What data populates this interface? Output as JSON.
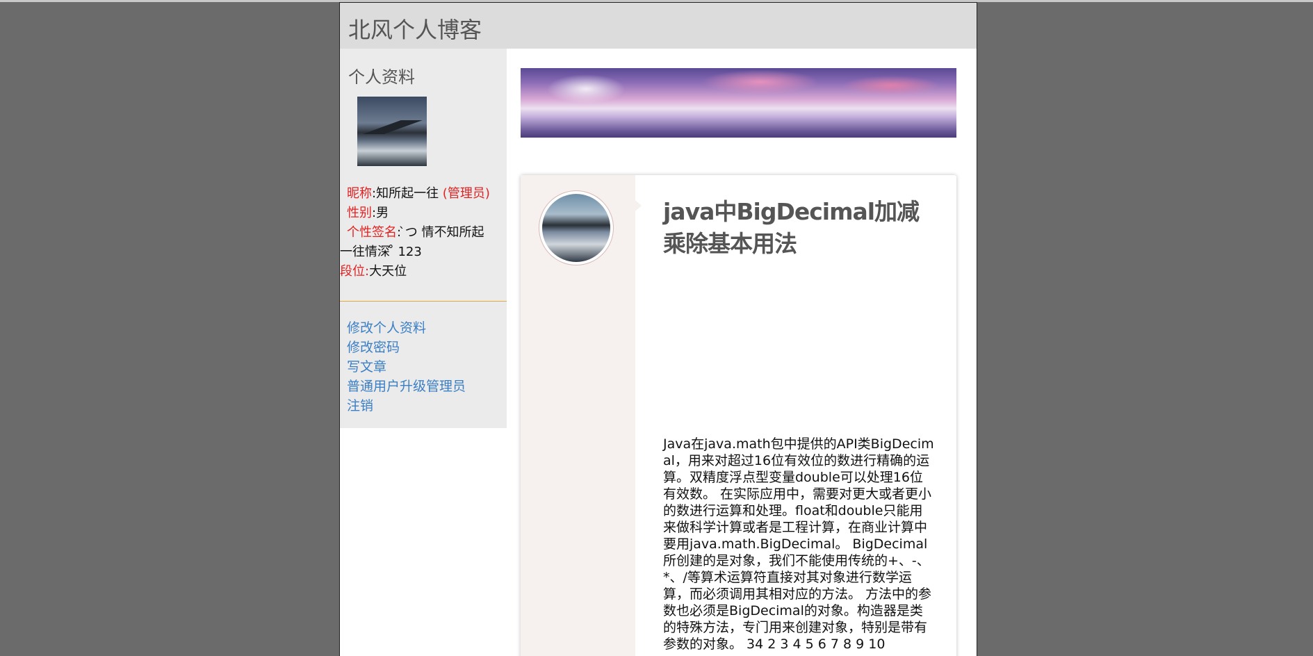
{
  "site": {
    "title": "北风个人博客"
  },
  "sidebar": {
    "heading": "个人资料",
    "profile": {
      "nickname_label": "昵称",
      "nickname_value": ":知所起一往 ",
      "role": "(管理员)",
      "gender_label": "性别",
      "gender_value": ":男",
      "signature_label": "个性签名",
      "signature_value_line1": ": ̀つ 情不知所起",
      "signature_value_line2": "一往情深 ̊ 123",
      "rank_label": "段位:",
      "rank_value": "大天位"
    },
    "links": [
      {
        "label": "修改个人资料"
      },
      {
        "label": "修改密码"
      },
      {
        "label": "写文章"
      },
      {
        "label": "普通用户升级管理员"
      },
      {
        "label": "注销"
      }
    ]
  },
  "article": {
    "title": "java中BigDecimal加减乘除基本用法",
    "body": "Java在java.math包中提供的API类BigDecimal，用来对超过16位有效位的数进行精确的运算。双精度浮点型变量double可以处理16位有效数。 在实际应用中，需要对更大或者更小的数进行运算和处理。float和double只能用来做科学计算或者是工程计算，在商业计算中要用java.math.BigDecimal。 BigDecimal所创建的是对象，我们不能使用传统的+、-、*、/等算术运算符直接对其对象进行数学运算，而必须调用其相对应的方法。 方法中的参数也必须是BigDecimal的对象。构造器是类的特殊方法，专门用来创建对象，特别是带有参数的对象。 34 2 3 4 5 6 7 8 9 10"
  },
  "colors": {
    "background": "#6b6b6b",
    "header": "#dcdcdc",
    "sidebar": "#ebebeb",
    "label_red": "#e12222",
    "link_blue": "#3a7fc5",
    "divider": "#e2a93b"
  }
}
